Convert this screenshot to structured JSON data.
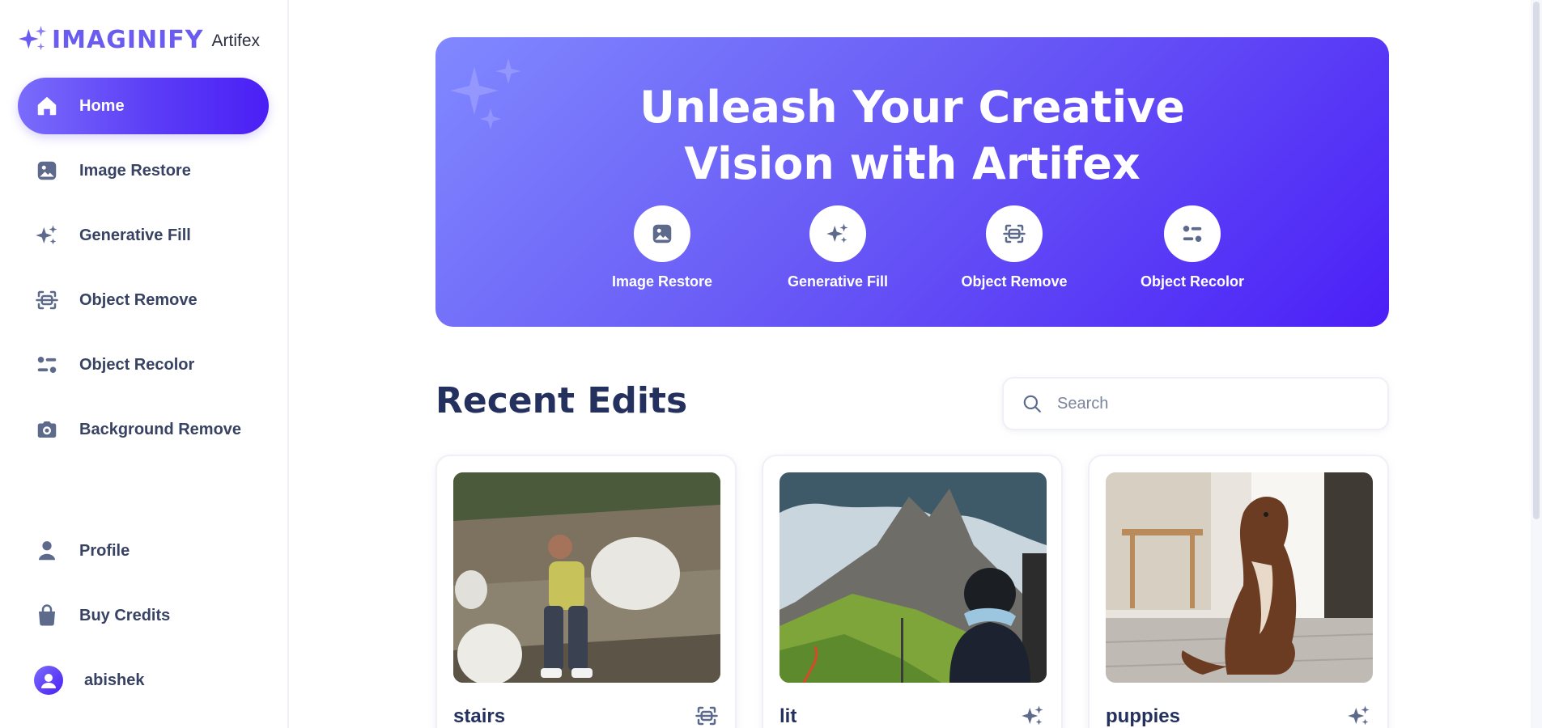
{
  "brand": {
    "name": "IMAGINIFY",
    "sub": "Artifex"
  },
  "sidebar": {
    "items": [
      {
        "label": "Home",
        "icon": "home-icon"
      },
      {
        "label": "Image Restore",
        "icon": "image-icon"
      },
      {
        "label": "Generative Fill",
        "icon": "stars-icon"
      },
      {
        "label": "Object Remove",
        "icon": "scan-icon"
      },
      {
        "label": "Object Recolor",
        "icon": "filter-icon"
      },
      {
        "label": "Background Remove",
        "icon": "camera-icon"
      }
    ],
    "bottom": [
      {
        "label": "Profile",
        "icon": "user-icon"
      },
      {
        "label": "Buy Credits",
        "icon": "bag-icon"
      }
    ],
    "user": {
      "name": "abishek"
    }
  },
  "banner": {
    "title_line1": "Unleash Your Creative",
    "title_line2": "Vision with Artifex",
    "tools": [
      {
        "label": "Image Restore",
        "icon": "image-icon"
      },
      {
        "label": "Generative Fill",
        "icon": "stars-icon"
      },
      {
        "label": "Object Remove",
        "icon": "scan-icon"
      },
      {
        "label": "Object Recolor",
        "icon": "filter-icon"
      }
    ]
  },
  "recent": {
    "title": "Recent Edits",
    "search_placeholder": "Search",
    "cards": [
      {
        "title": "stairs",
        "icon": "scan-icon"
      },
      {
        "title": "lit",
        "icon": "stars-icon"
      },
      {
        "title": "puppies",
        "icon": "stars-icon"
      }
    ]
  },
  "colors": {
    "accent": "#5b3cf6",
    "text": "#384262",
    "heading": "#24305e"
  }
}
